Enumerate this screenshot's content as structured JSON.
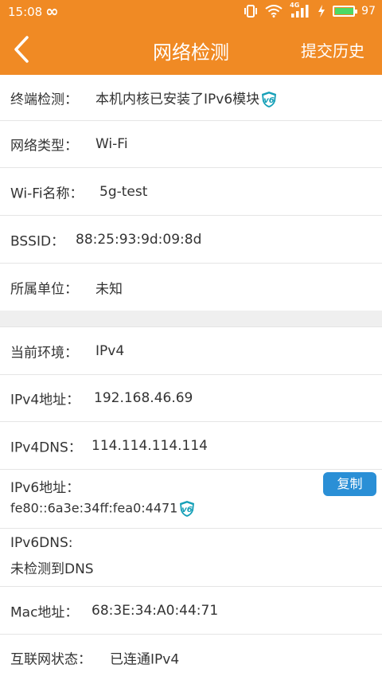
{
  "status_bar": {
    "time": "15:08",
    "loop_glyph": "∞",
    "network_type": "4G",
    "battery": "97",
    "battery_level": 0.97,
    "icons": [
      "vibrate-icon",
      "wifi-icon",
      "signal-icon",
      "charging-icon",
      "battery-icon"
    ]
  },
  "nav": {
    "title": "网络检测",
    "history": "提交历史",
    "back_icon": "chevron-left-icon"
  },
  "colors": {
    "header": "#f08a24",
    "copy_button": "#2a8fd6",
    "badge": "#16a0b8"
  },
  "info": {
    "terminal_label": "终端检测：",
    "terminal_value": "本机内核已安装了IPv6模块",
    "network_type_label": "网络类型：",
    "network_type_value": "Wi-Fi",
    "wifi_name_label": "Wi-Fi名称：",
    "wifi_name_value": "5g-test",
    "bssid_label": "BSSID：",
    "bssid_value": "88:25:93:9d:09:8d",
    "unit_label": "所属单位：",
    "unit_value": "未知"
  },
  "env": {
    "current_label": "当前环境：",
    "current_value": "IPv4",
    "ipv4_label": "IPv4地址：",
    "ipv4_value": "192.168.46.69",
    "ipv4dns_label": "IPv4DNS：",
    "ipv4dns_value": "114.114.114.114",
    "ipv6_label": "IPv6地址：",
    "ipv6_value": "fe80::6a3e:34ff:fea0:4471",
    "copy_label": "复制",
    "ipv6dns_label": "IPv6DNS:",
    "ipv6dns_value": "未检测到DNS",
    "mac_label": "Mac地址：",
    "mac_value": "68:3E:34:A0:44:71",
    "internet_label": "互联网状态：",
    "internet_value": "已连通IPv4"
  },
  "badge_text": "v6"
}
